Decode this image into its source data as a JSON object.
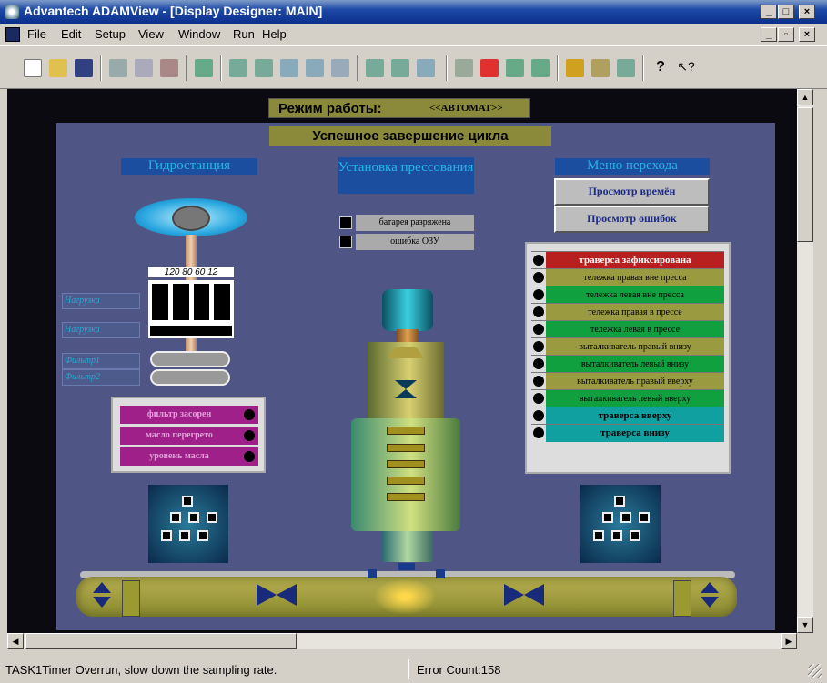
{
  "window": {
    "title": "Advantech ADAMView - [Display Designer: MAIN]",
    "min": "_",
    "max": "□",
    "close": "×",
    "restore": "▫"
  },
  "menu": [
    "File",
    "Edit",
    "Setup",
    "View",
    "Window",
    "Run",
    "Help"
  ],
  "display": {
    "mode_label": "Режим работы:",
    "mode_value": "<<АВТОМАТ>>",
    "cycle_status": "Успешное завершение цикла",
    "sections": {
      "hydro": "Гидростанция",
      "press": "Установка прессования",
      "menu": "Меню перехода"
    },
    "buttons": {
      "view_times": "Просмотр времён",
      "view_errors": "Просмотр ошибок"
    },
    "gauge_scale": "120 80 60 12",
    "side_labels": [
      "Нагрузка",
      "Нагрузка",
      "Фильтр1",
      "Фильтр2"
    ],
    "hydro_alarms": [
      "фильтр засорен",
      "масло перегрето",
      "уровень масла"
    ],
    "press_status": [
      "батарея разряжена",
      "ошибка ОЗУ"
    ],
    "alarms": [
      {
        "label": "траверса зафиксирована",
        "color": "#b82020",
        "bold": true,
        "text": "#ffffff"
      },
      {
        "label": "тележка правая вне пресса",
        "color": "#9a9a40",
        "bold": false,
        "text": "#000000"
      },
      {
        "label": "тележка левая вне пресса",
        "color": "#10a040",
        "bold": false,
        "text": "#000000"
      },
      {
        "label": "тележка правая в прессе",
        "color": "#9a9a40",
        "bold": false,
        "text": "#000000"
      },
      {
        "label": "тележка левая в прессе",
        "color": "#10a040",
        "bold": false,
        "text": "#000000"
      },
      {
        "label": "выталкиватель правый внизу",
        "color": "#9a9a40",
        "bold": false,
        "text": "#000000"
      },
      {
        "label": "выталкиватель левый внизу",
        "color": "#10a040",
        "bold": false,
        "text": "#000000"
      },
      {
        "label": "выталкиватель правый вверху",
        "color": "#9a9a40",
        "bold": false,
        "text": "#000000"
      },
      {
        "label": "выталкиватель левый вверху",
        "color": "#10a040",
        "bold": false,
        "text": "#000000"
      },
      {
        "label": "траверса вверху",
        "color": "#10a0a0",
        "bold": true,
        "text": "#000000"
      },
      {
        "label": "траверса внизу",
        "color": "#10a0a0",
        "bold": true,
        "text": "#000000"
      }
    ]
  },
  "status": {
    "message": "TASK1Timer Overrun, slow down the sampling rate.",
    "errors": "Error Count:158"
  }
}
